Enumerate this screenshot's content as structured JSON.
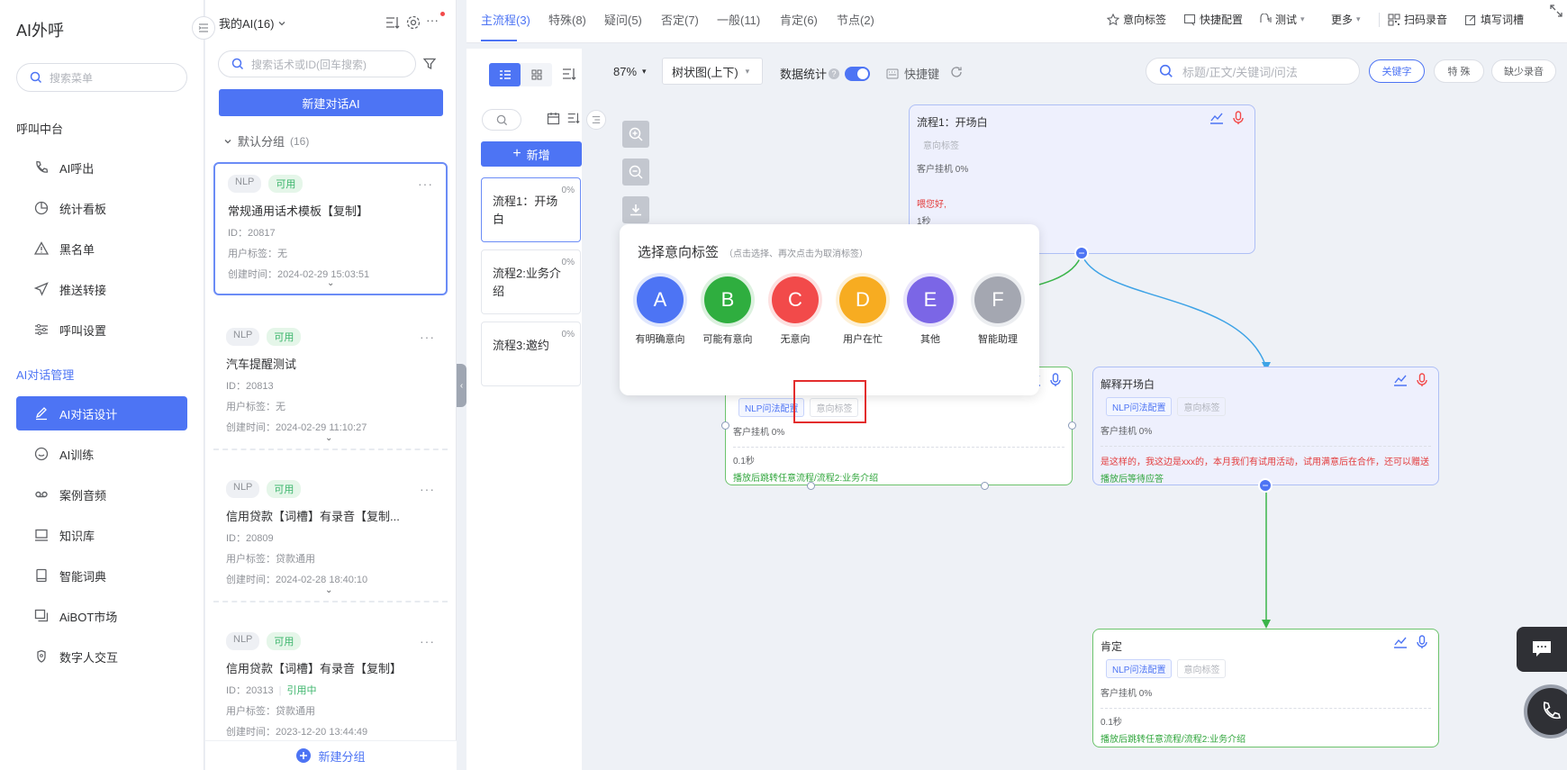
{
  "brand": "AI外呼",
  "sidebar": {
    "search_placeholder": "搜索菜单",
    "section1": "呼叫中台",
    "section2": "AI对话管理",
    "items": [
      {
        "label": "AI呼出",
        "icon": "phone-icon"
      },
      {
        "label": "统计看板",
        "icon": "pie-chart-icon"
      },
      {
        "label": "黑名单",
        "icon": "warning-icon"
      },
      {
        "label": "推送转接",
        "icon": "send-icon"
      },
      {
        "label": "呼叫设置",
        "icon": "sliders-icon"
      },
      {
        "label": "AI对话设计",
        "icon": "edit-icon",
        "active": true
      },
      {
        "label": "AI训练",
        "icon": "chat-icon"
      },
      {
        "label": "案例音频",
        "icon": "tape-icon"
      },
      {
        "label": "知识库",
        "icon": "monitor-icon"
      },
      {
        "label": "智能词典",
        "icon": "book-icon"
      },
      {
        "label": "AiBOT市场",
        "icon": "window-icon"
      },
      {
        "label": "数字人交互",
        "icon": "robot-icon"
      }
    ]
  },
  "list": {
    "title": "我的AI(16)",
    "search_placeholder": "搜索话术或ID(回车搜索)",
    "new_button": "新建对话AI",
    "group": "默认分组",
    "group_count": "(16)",
    "new_group": "新建分组",
    "cards": [
      {
        "tag1": "NLP",
        "tag2": "可用",
        "title": "常规通用话术模板【复制】",
        "id": "ID：20817",
        "user_tag": "用户标签：无",
        "created": "创建时间：2024-02-29 15:03:51"
      },
      {
        "tag1": "NLP",
        "tag2": "可用",
        "title": "汽车提醒测试",
        "id": "ID：20813",
        "user_tag": "用户标签：无",
        "created": "创建时间：2024-02-29 11:10:27"
      },
      {
        "tag1": "NLP",
        "tag2": "可用",
        "title": "信用贷款【词槽】有录音【复制...",
        "id": "ID：20809",
        "user_tag": "用户标签：贷款通用",
        "created": "创建时间：2024-02-28 18:40:10"
      },
      {
        "tag1": "NLP",
        "tag2": "可用",
        "title": "信用贷款【词槽】有录音【复制】",
        "id": "ID：20313",
        "in_use": "引用中",
        "user_tag": "用户标签：贷款通用",
        "created": "创建时间：2023-12-20 13:44:49"
      }
    ]
  },
  "tabs": [
    "主流程(3)",
    "特殊(8)",
    "疑问(5)",
    "否定(7)",
    "一般(11)",
    "肯定(6)",
    "节点(2)"
  ],
  "tools": [
    "意向标签",
    "快捷配置",
    "测试",
    "更多",
    "扫码录音",
    "填写词槽"
  ],
  "steps": {
    "new_button": "新增",
    "items": [
      {
        "label": "流程1：开场白",
        "pct": "0%"
      },
      {
        "label": "流程2:业务介绍",
        "pct": "0%"
      },
      {
        "label": "流程3:邀约",
        "pct": "0%"
      }
    ]
  },
  "canvas": {
    "zoom": "87%",
    "layout": "树状图(上下)",
    "stats_label": "数据统计",
    "shortcut": "快捷键",
    "search_placeholder": "标题/正文/关键词/问法",
    "pills": [
      "关键字",
      "特 殊",
      "缺少录音"
    ]
  },
  "nodes": {
    "n1": {
      "title": "流程1：开场白",
      "chip2": "意向标签",
      "hangup": "客户挂机 0%",
      "red": "喂您好,",
      "time": "1秒"
    },
    "n2": {
      "chip1": "NLP问法配置",
      "chip2": "意向标签",
      "hangup": "客户挂机 0%",
      "time": "0.1秒",
      "green": "播放后跳转任意流程/流程2:业务介绍"
    },
    "n3": {
      "title": "解释开场白",
      "chip1": "NLP问法配置",
      "chip2": "意向标签",
      "hangup": "客户挂机 0%",
      "red": "是这样的，我这边是xxx的，本月我们有试用活动，试用满意后在合作，还可以赠送",
      "green": "播放后等待应答"
    },
    "n4": {
      "title": "肯定",
      "chip1": "NLP问法配置",
      "chip2": "意向标签",
      "hangup": "客户挂机 0%",
      "time": "0.1秒",
      "green": "播放后跳转任意流程/流程2:业务介绍"
    }
  },
  "popup": {
    "title": "选择意向标签",
    "hint": "（点击选择、再次点击为取消标签）",
    "options": [
      {
        "letter": "A",
        "label": "有明确意向",
        "color": "#4d74f4"
      },
      {
        "letter": "B",
        "label": "可能有意向",
        "color": "#2fae3f"
      },
      {
        "letter": "C",
        "label": "无意向",
        "color": "#f24a4a"
      },
      {
        "letter": "D",
        "label": "用户在忙",
        "color": "#f7ac21"
      },
      {
        "letter": "E",
        "label": "其他",
        "color": "#7b66e6"
      },
      {
        "letter": "F",
        "label": "智能助理",
        "color": "#a4a7b1"
      }
    ]
  }
}
